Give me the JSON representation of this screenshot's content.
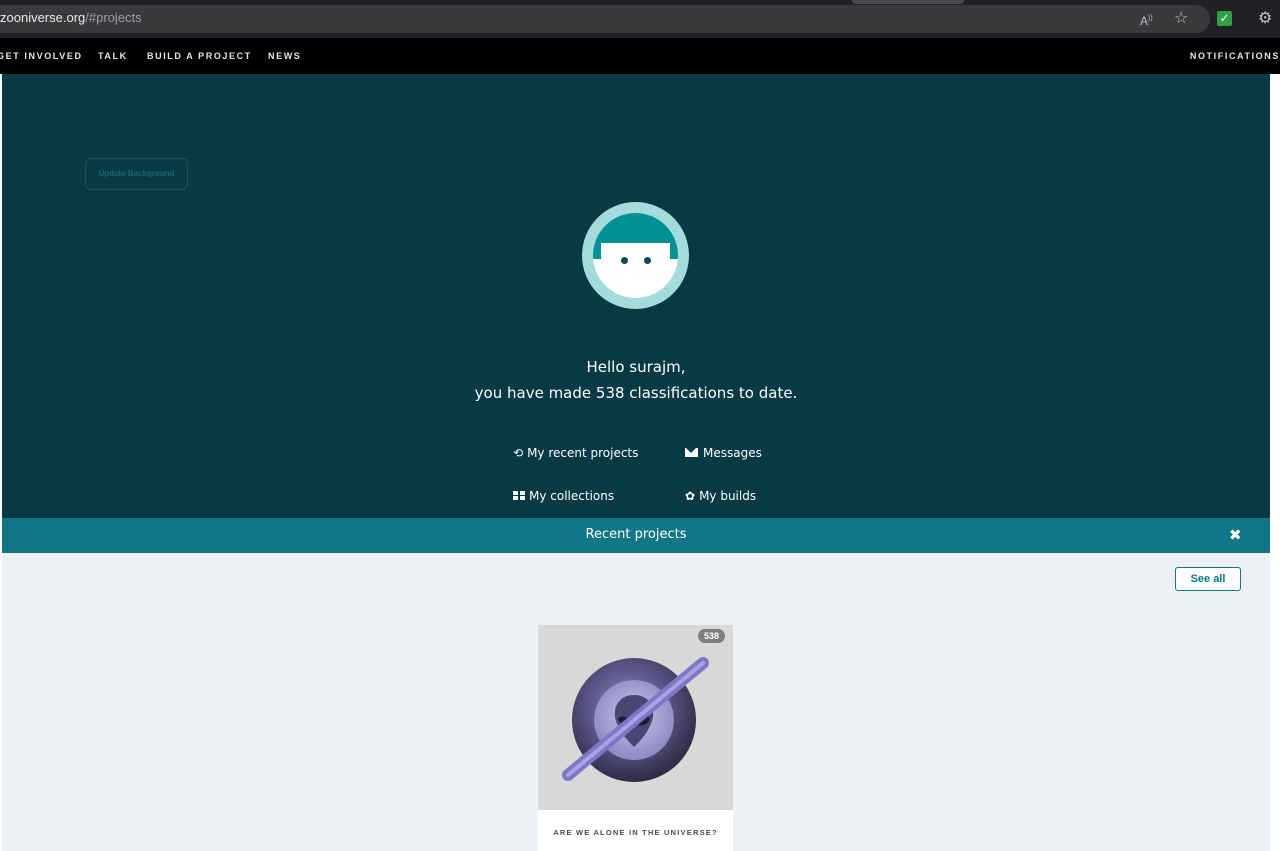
{
  "browser": {
    "url_host": "zooniverse.org",
    "url_path": "/#projects"
  },
  "nav": {
    "get_involved": "GET INVOLVED",
    "talk": "TALK",
    "build_a_project": "BUILD A PROJECT",
    "news": "NEWS",
    "notifications": "NOTIFICATIONS"
  },
  "hero": {
    "update_background": "Update Background",
    "greeting_line1": "Hello surajm,",
    "greeting_line2": "you have made 538 classifications to date.",
    "links": {
      "recent_projects": "My recent projects",
      "messages": "Messages",
      "collections": "My collections",
      "builds": "My builds"
    }
  },
  "recent": {
    "title": "Recent projects",
    "see_all": "See all",
    "projects": [
      {
        "title": "ARE WE ALONE IN THE UNIVERSE?",
        "classifications": "538"
      }
    ]
  },
  "colors": {
    "hero_bg": "#083a45",
    "accent": "#107786",
    "nav_bg": "#000000"
  }
}
